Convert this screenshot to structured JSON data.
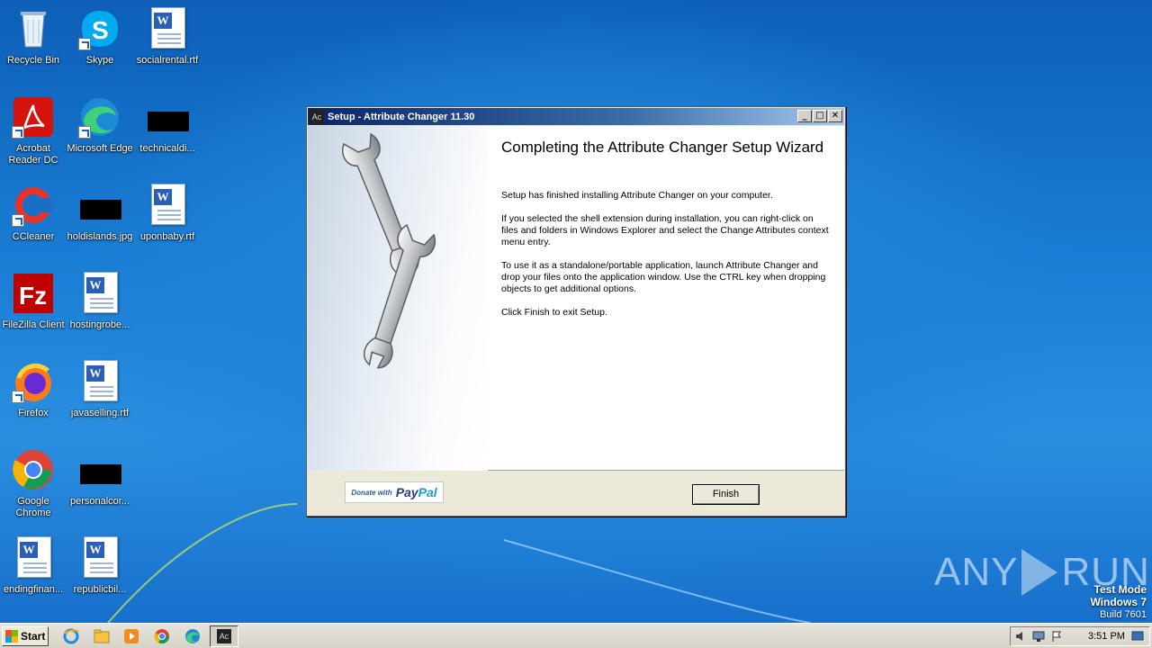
{
  "desktop": {
    "icons": [
      {
        "label": "Recycle Bin"
      },
      {
        "label": "Skype"
      },
      {
        "label": "socialrental.rtf"
      },
      {
        "label": "Acrobat Reader DC"
      },
      {
        "label": "Microsoft Edge"
      },
      {
        "label": "technicaldi..."
      },
      {
        "label": "CCleaner"
      },
      {
        "label": "holdislands.jpg"
      },
      {
        "label": "uponbaby.rtf"
      },
      {
        "label": "FileZilla Client"
      },
      {
        "label": "hostingrobe..."
      },
      {
        "label": "Firefox"
      },
      {
        "label": "javaselling.rtf"
      },
      {
        "label": "Google Chrome"
      },
      {
        "label": "personalcor..."
      },
      {
        "label": "endingfinan..."
      },
      {
        "label": "republicbil..."
      }
    ],
    "watermark": {
      "left": "ANY",
      "right": "RUN"
    },
    "test_mode": {
      "line1": "Test Mode",
      "line2": "Windows 7",
      "line3": "Build 7601"
    }
  },
  "window": {
    "icon_text": "Ac",
    "title": "Setup - Attribute Changer 11.30",
    "heading": "Completing the Attribute Changer Setup Wizard",
    "paragraphs": [
      "Setup has finished installing Attribute Changer on your computer.",
      "If you selected the shell extension during installation, you can right-click on files and folders in Windows Explorer and select the Change Attributes context menu entry.",
      "To use it as a standalone/portable application, launch Attribute Changer and drop your files onto the application window. Use the CTRL key when dropping objects to get additional options.",
      "Click Finish to exit Setup."
    ],
    "paypal": {
      "donate": "Donate with",
      "pay": "Pay",
      "pal": "Pal"
    },
    "finish_label": "Finish",
    "controls": {
      "minimize": "_",
      "maximize": "□",
      "close": "✕"
    }
  },
  "taskbar": {
    "start_label": "Start",
    "active_task_icon": "Ac",
    "clock": "3:51 PM"
  }
}
